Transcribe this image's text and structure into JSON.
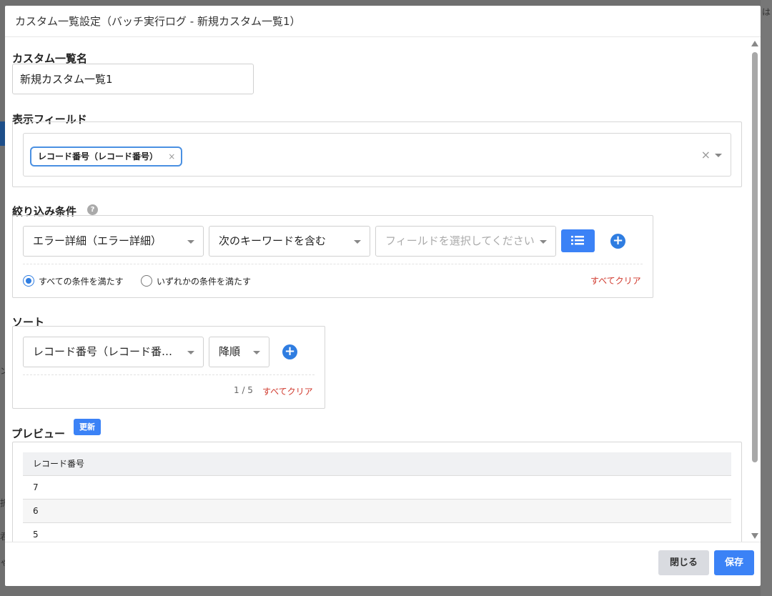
{
  "background": {
    "snippets": [
      "は",
      "ン",
      "択",
      "君",
      "ゃ"
    ]
  },
  "modal": {
    "title": "カスタム一覧設定（バッチ実行ログ - 新規カスタム一覧1）",
    "name_section": {
      "label": "カスタム一覧名",
      "value": "新規カスタム一覧1"
    },
    "fields_section": {
      "label": "表示フィールド",
      "chips": [
        "レコード番号（レコード番号）"
      ],
      "chip_remove": "×",
      "clear": "×"
    },
    "filter_section": {
      "label": "絞り込み条件",
      "help": "?",
      "field_select": "エラー詳細（エラー詳細）",
      "operator_select": "次のキーワードを含む",
      "value_placeholder": "フィールドを選択してください",
      "add": "+",
      "match_all": "すべての条件を満たす",
      "match_any": "いずれかの条件を満たす",
      "clear_all": "すべてクリア"
    },
    "sort_section": {
      "label": "ソート",
      "field_select": "レコード番号（レコード番…",
      "order_select": "降順",
      "add": "+",
      "counter": "1 / 5",
      "clear_all": "すべてクリア"
    },
    "preview_section": {
      "label": "プレビュー",
      "update_button": "更新",
      "columns": [
        "レコード番号"
      ],
      "rows": [
        "7",
        "6",
        "5"
      ]
    },
    "footer": {
      "close": "閉じる",
      "save": "保存"
    }
  },
  "colors": {
    "accent": "#3b82f6",
    "danger": "#d0382c"
  }
}
